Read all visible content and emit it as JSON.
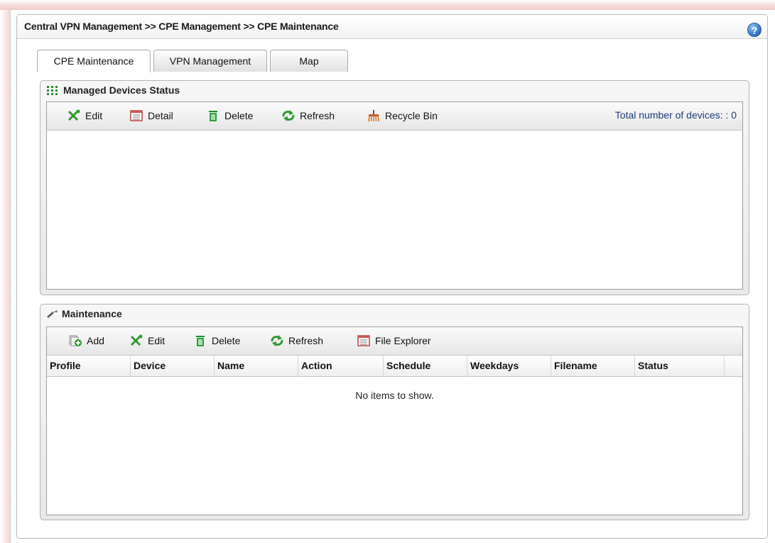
{
  "breadcrumb": "Central VPN Management >> CPE Management >> CPE Maintenance",
  "help_icon_label": "?",
  "tabs": [
    {
      "label": "CPE Maintenance",
      "active": true
    },
    {
      "label": "VPN Management",
      "active": false
    },
    {
      "label": "Map",
      "active": false
    }
  ],
  "managed": {
    "title": "Managed Devices Status",
    "toolbar": {
      "edit": "Edit",
      "detail": "Detail",
      "delete": "Delete",
      "refresh": "Refresh",
      "recycle": "Recycle Bin"
    },
    "total_label": "Total number of devices: : 0"
  },
  "maintenance": {
    "title": "Maintenance",
    "toolbar": {
      "add": "Add",
      "edit": "Edit",
      "delete": "Delete",
      "refresh": "Refresh",
      "explorer": "File Explorer"
    },
    "columns": [
      "Profile",
      "Device",
      "Name",
      "Action",
      "Schedule",
      "Weekdays",
      "Filename",
      "Status"
    ],
    "empty_text": "No items to show."
  },
  "colors": {
    "accent_green": "#2f9a2f",
    "link_blue": "#1d3c7c",
    "border": "#b3b3b3"
  }
}
